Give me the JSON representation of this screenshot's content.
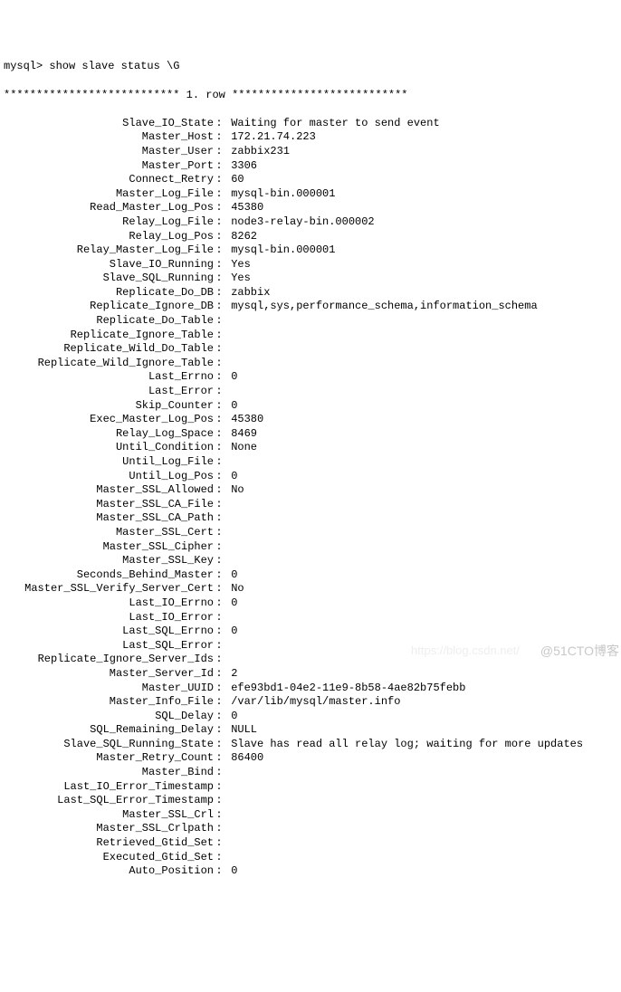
{
  "prompt": "mysql> show slave status \\G",
  "row_header_left": "*************************** 1. ",
  "row_header_mid": "row ",
  "row_header_right": "***************************",
  "fields": [
    {
      "key": "Slave_IO_State",
      "val": "Waiting for master to send event"
    },
    {
      "key": "Master_Host",
      "val": "172.21.74.223"
    },
    {
      "key": "Master_User",
      "val": "zabbix231"
    },
    {
      "key": "Master_Port",
      "val": "3306"
    },
    {
      "key": "Connect_Retry",
      "val": "60"
    },
    {
      "key": "Master_Log_File",
      "val": "mysql-bin.000001"
    },
    {
      "key": "Read_Master_Log_Pos",
      "val": "45380"
    },
    {
      "key": "Relay_Log_File",
      "val": "node3-relay-bin.000002"
    },
    {
      "key": "Relay_Log_Pos",
      "val": "8262"
    },
    {
      "key": "Relay_Master_Log_File",
      "val": "mysql-bin.000001"
    },
    {
      "key": "Slave_IO_Running",
      "val": "Yes"
    },
    {
      "key": "Slave_SQL_Running",
      "val": "Yes"
    },
    {
      "key": "Replicate_Do_DB",
      "val": "zabbix"
    },
    {
      "key": "Replicate_Ignore_DB",
      "val": "mysql,sys,performance_schema,information_schema"
    },
    {
      "key": "Replicate_Do_Table",
      "val": ""
    },
    {
      "key": "Replicate_Ignore_Table",
      "val": ""
    },
    {
      "key": "Replicate_Wild_Do_Table",
      "val": ""
    },
    {
      "key": "Replicate_Wild_Ignore_Table",
      "val": ""
    },
    {
      "key": "Last_Errno",
      "val": "0"
    },
    {
      "key": "Last_Error",
      "val": ""
    },
    {
      "key": "Skip_Counter",
      "val": "0"
    },
    {
      "key": "Exec_Master_Log_Pos",
      "val": "45380"
    },
    {
      "key": "Relay_Log_Space",
      "val": "8469"
    },
    {
      "key": "Until_Condition",
      "val": "None"
    },
    {
      "key": "Until_Log_File",
      "val": ""
    },
    {
      "key": "Until_Log_Pos",
      "val": "0"
    },
    {
      "key": "Master_SSL_Allowed",
      "val": "No"
    },
    {
      "key": "Master_SSL_CA_File",
      "val": ""
    },
    {
      "key": "Master_SSL_CA_Path",
      "val": ""
    },
    {
      "key": "Master_SSL_Cert",
      "val": ""
    },
    {
      "key": "Master_SSL_Cipher",
      "val": ""
    },
    {
      "key": "Master_SSL_Key",
      "val": ""
    },
    {
      "key": "Seconds_Behind_Master",
      "val": "0"
    },
    {
      "key": "Master_SSL_Verify_Server_Cert",
      "val": "No"
    },
    {
      "key": "Last_IO_Errno",
      "val": "0"
    },
    {
      "key": "Last_IO_Error",
      "val": ""
    },
    {
      "key": "Last_SQL_Errno",
      "val": "0"
    },
    {
      "key": "Last_SQL_Error",
      "val": ""
    },
    {
      "key": "Replicate_Ignore_Server_Ids",
      "val": ""
    },
    {
      "key": "Master_Server_Id",
      "val": "2"
    },
    {
      "key": "Master_UUID",
      "val": "efe93bd1-04e2-11e9-8b58-4ae82b75febb"
    },
    {
      "key": "Master_Info_File",
      "val": "/var/lib/mysql/master.info"
    },
    {
      "key": "SQL_Delay",
      "val": "0"
    },
    {
      "key": "SQL_Remaining_Delay",
      "val": "NULL"
    },
    {
      "key": "Slave_SQL_Running_State",
      "val": "Slave has read all relay log; waiting for more updates"
    },
    {
      "key": "Master_Retry_Count",
      "val": "86400"
    },
    {
      "key": "Master_Bind",
      "val": ""
    },
    {
      "key": "Last_IO_Error_Timestamp",
      "val": ""
    },
    {
      "key": "Last_SQL_Error_Timestamp",
      "val": ""
    },
    {
      "key": "Master_SSL_Crl",
      "val": ""
    },
    {
      "key": "Master_SSL_Crlpath",
      "val": ""
    },
    {
      "key": "Retrieved_Gtid_Set",
      "val": ""
    },
    {
      "key": "Executed_Gtid_Set",
      "val": ""
    },
    {
      "key": "Auto_Position",
      "val": "0"
    }
  ],
  "watermark_center": "https://blog.csdn.net/",
  "watermark_right": "@51CTO博客"
}
